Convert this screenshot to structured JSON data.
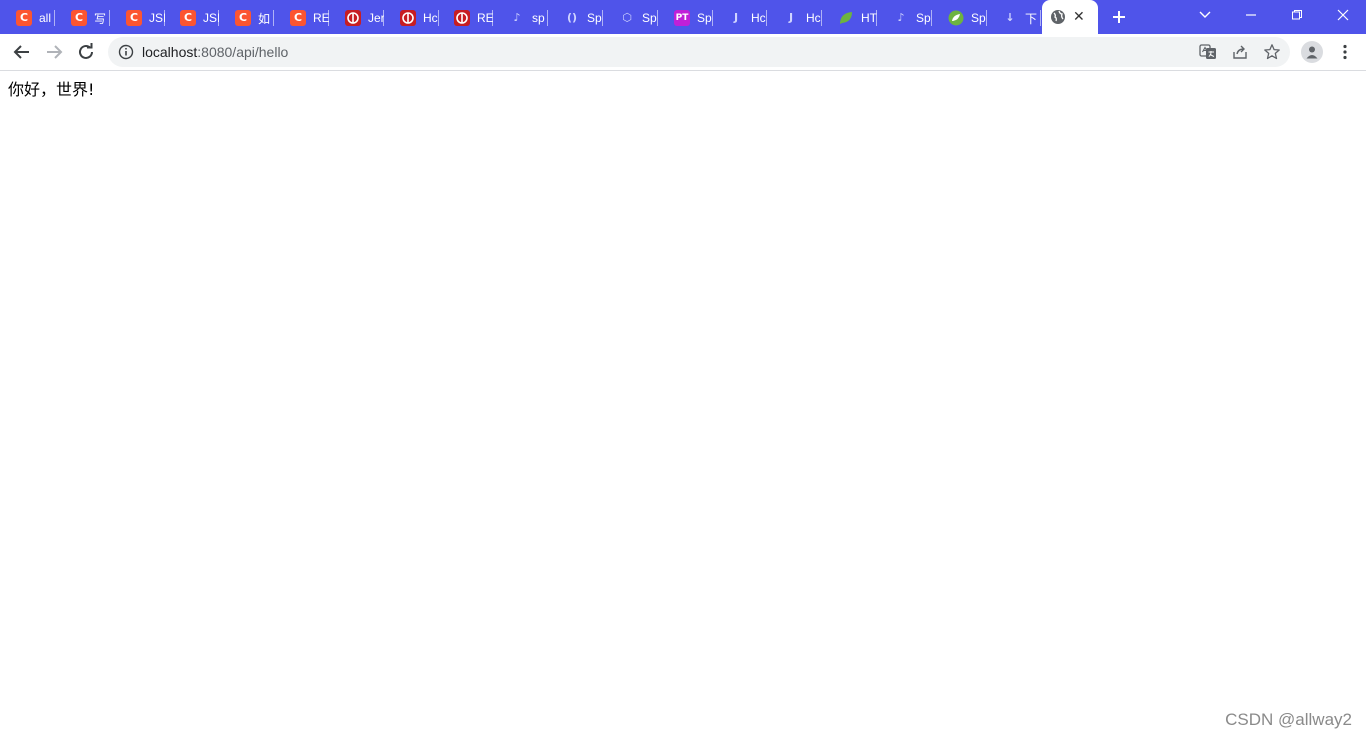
{
  "tabs": [
    {
      "label": "all",
      "icon": "csdn-icon",
      "icon_text": "C",
      "color": "#fc5531"
    },
    {
      "label": "写",
      "icon": "csdn-icon",
      "icon_text": "C",
      "color": "#fc5531"
    },
    {
      "label": "JSI",
      "icon": "csdn-icon",
      "icon_text": "C",
      "color": "#fc5531"
    },
    {
      "label": "JSI",
      "icon": "csdn-icon",
      "icon_text": "C",
      "color": "#fc5531"
    },
    {
      "label": "如",
      "icon": "csdn-icon",
      "icon_text": "C",
      "color": "#fc5531"
    },
    {
      "label": "RE",
      "icon": "csdn-icon",
      "icon_text": "C",
      "color": "#fc5531"
    },
    {
      "label": "Jer",
      "icon": "oschina-icon",
      "icon_text": "",
      "color": "#c71d23"
    },
    {
      "label": "Hc",
      "icon": "oschina-icon",
      "icon_text": "",
      "color": "#c71d23"
    },
    {
      "label": "RE",
      "icon": "oschina-icon",
      "icon_text": "",
      "color": "#c71d23"
    },
    {
      "label": "sp",
      "icon": "note-icon",
      "icon_text": "♪",
      "color": "#4f54ea"
    },
    {
      "label": "Sp",
      "icon": "bracket-icon",
      "icon_text": "()",
      "color": "#4f54ea"
    },
    {
      "label": "Sp",
      "icon": "hexagon-icon",
      "icon_text": "⬡",
      "color": "#7b1fa2"
    },
    {
      "label": "Sp",
      "icon": "pt-icon",
      "icon_text": "PT",
      "color": "#c020d8"
    },
    {
      "label": "Hc",
      "icon": "jb-icon",
      "icon_text": "J",
      "color": "#4f54ea"
    },
    {
      "label": "Hc",
      "icon": "jb-icon",
      "icon_text": "J",
      "color": "#4f54ea"
    },
    {
      "label": "HT",
      "icon": "leaf-icon",
      "icon_text": "",
      "color": "#6db33f"
    },
    {
      "label": "Sp",
      "icon": "note-icon",
      "icon_text": "♪",
      "color": "#4f54ea"
    },
    {
      "label": "Sp",
      "icon": "spring-icon",
      "icon_text": "",
      "color": "#6db33f"
    },
    {
      "label": "下",
      "icon": "download-icon",
      "icon_text": "↓",
      "color": "#4f54ea"
    }
  ],
  "active_tab": {
    "icon": "globe-icon"
  },
  "address_bar": {
    "host": "localhost",
    "rest": ":8080/api/hello"
  },
  "page": {
    "text": "你好，世界!"
  },
  "watermark": "CSDN @allway2",
  "colors": {
    "tabstrip": "#4f54ea",
    "omnibox": "#f1f3f4"
  }
}
